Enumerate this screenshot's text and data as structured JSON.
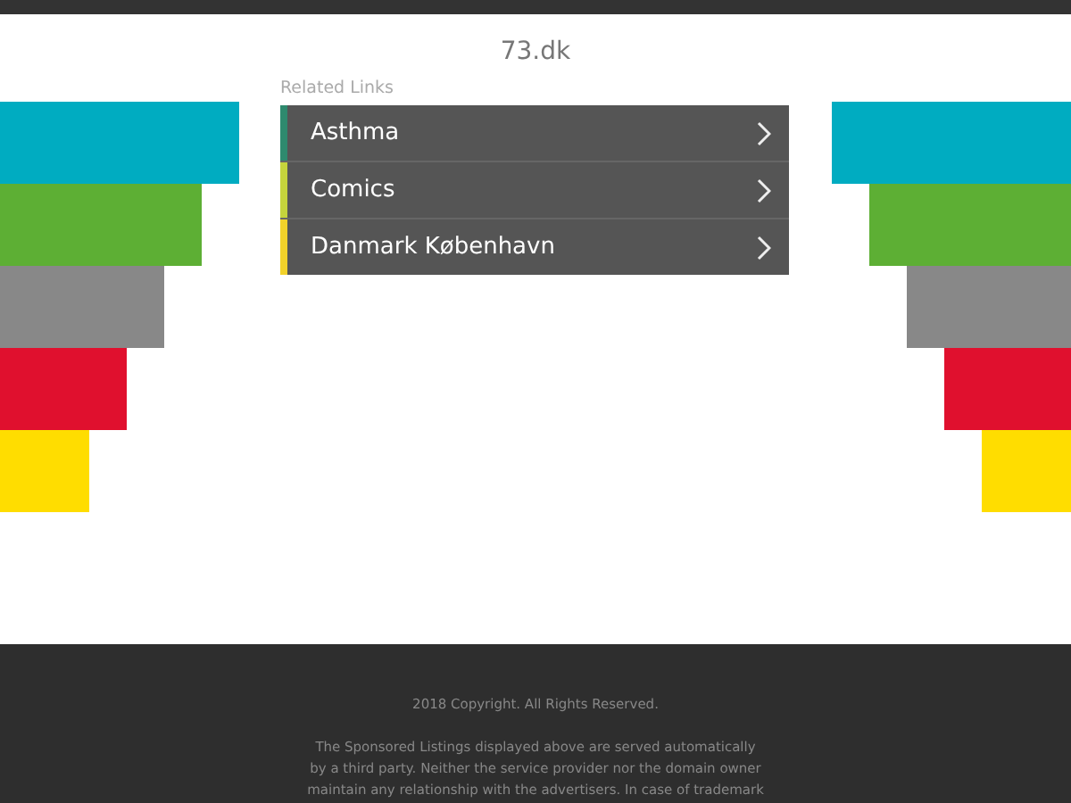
{
  "site_title": "73.dk",
  "related_links": {
    "heading": "Related Links",
    "items": [
      {
        "label": "Asthma",
        "color": "#2e8a6e"
      },
      {
        "label": "Comics",
        "color": "#c5d43c"
      },
      {
        "label": "Danmark København",
        "color": "#f2d22a"
      }
    ]
  },
  "footer": {
    "copyright": "2018 Copyright. All Rights Reserved.",
    "disclaimer": "The Sponsored Listings displayed above are served automatically\nby a third party. Neither the service provider nor the domain owner\nmaintain any relationship with the advertisers. In case of trademark"
  }
}
